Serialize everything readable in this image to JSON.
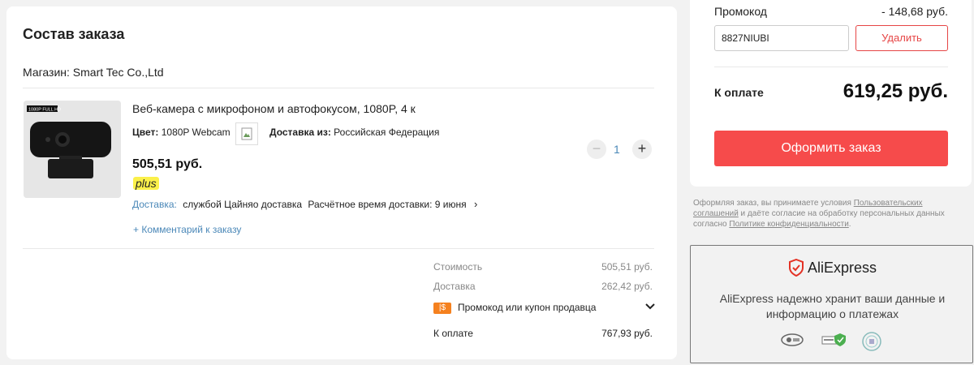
{
  "order": {
    "title": "Состав заказа",
    "store": "Магазин: Smart Tec Co.,Ltd",
    "product": {
      "name": "Веб-камера с микрофоном и автофокусом, 1080P, 4 к",
      "color_label": "Цвет:",
      "color_value": "1080P Webcam",
      "ship_from_label": "Доставка из:",
      "ship_from_value": "Российская Федерация",
      "price": "505,51 руб.",
      "plus": "plus",
      "delivery_label": "Доставка:",
      "delivery_value": "службой Цайняо доставка",
      "delivery_eta": "Расчётное время доставки: 9 июня",
      "comment": "+ Комментарий к заказу",
      "quantity": "1",
      "image_text": "1080P FULL HD"
    },
    "summary": {
      "cost_label": "Стоимость",
      "cost_value": "505,51 руб.",
      "shipping_label": "Доставка",
      "shipping_value": "262,42 руб.",
      "coupon_label": "Промокод или купон продавца",
      "total_label": "К оплате",
      "total_value": "767,93 руб."
    }
  },
  "checkout": {
    "promo_label": "Промокод",
    "promo_discount": "- 148,68 руб.",
    "promo_code": "8827NIUBI",
    "remove_label": "Удалить",
    "pay_label": "К оплате",
    "pay_value": "619,25 руб.",
    "order_button": "Оформить заказ"
  },
  "terms": {
    "t1": "Оформляя заказ, вы принимаете условия ",
    "link1": "Пользовательских соглашений",
    "t2": " и даёте согласие на обработку персональных данных согласно ",
    "link2": "Политике конфиденциальности",
    "t3": "."
  },
  "security": {
    "brand": "AliExpress",
    "text": "AliExpress надежно хранит ваши данные и информацию о платежах"
  },
  "colors": {
    "accent": "#f64b4b",
    "link": "#4b88b8",
    "plus_bg": "#fbf04a",
    "coupon": "#f5811f"
  }
}
